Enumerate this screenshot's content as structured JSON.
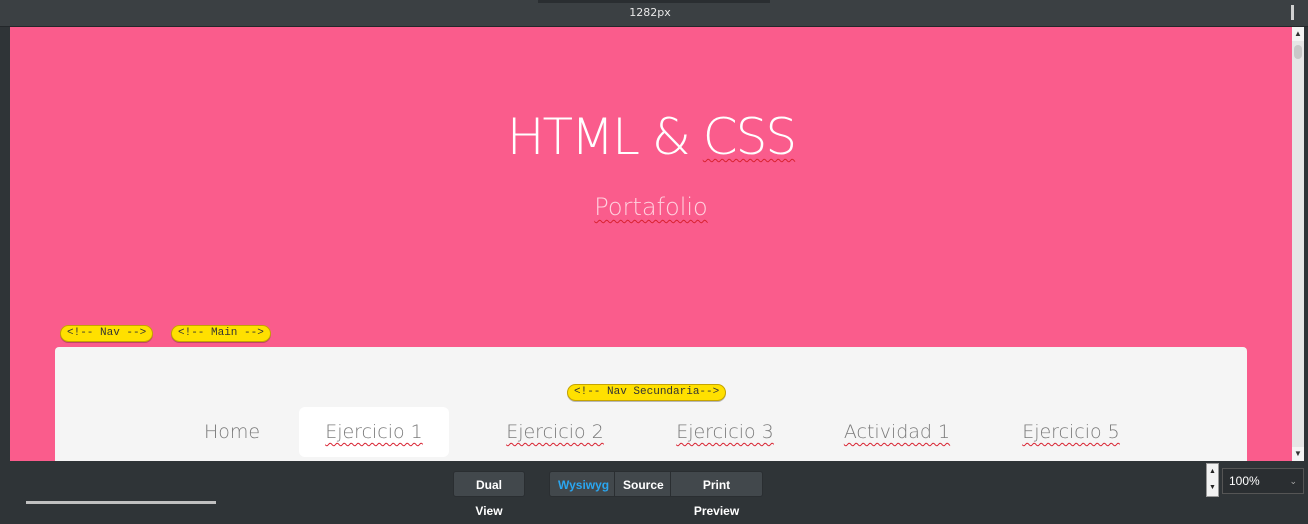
{
  "ruler": {
    "width_label": "1282px"
  },
  "hero": {
    "title": "HTML & CSS",
    "subtitle": "Portafolio"
  },
  "tags": {
    "nav": "<!-- Nav -->",
    "main": "<!-- Main -->",
    "nav_secundaria": "<!-- Nav Secundaria-->"
  },
  "nav": {
    "items": [
      {
        "label": "Home"
      },
      {
        "label": "Ejercicio 1"
      },
      {
        "label": "Ejercicio 2"
      },
      {
        "label": "Ejercicio 3"
      },
      {
        "label": "Actividad 1"
      },
      {
        "label": "Ejercicio 5"
      }
    ],
    "active_index": 1
  },
  "toolbar": {
    "dual_view": "Dual View",
    "wysiwyg": "Wysiwyg",
    "source": "Source",
    "print_preview": "Print Preview",
    "active_view": "Wysiwyg",
    "zoom": "100%"
  },
  "colors": {
    "hero_bg": "#fa5c8c",
    "panel_bg": "#f5f5f5",
    "tag_bg": "#ffe000",
    "active_tab_text": "#2aa6f0"
  }
}
